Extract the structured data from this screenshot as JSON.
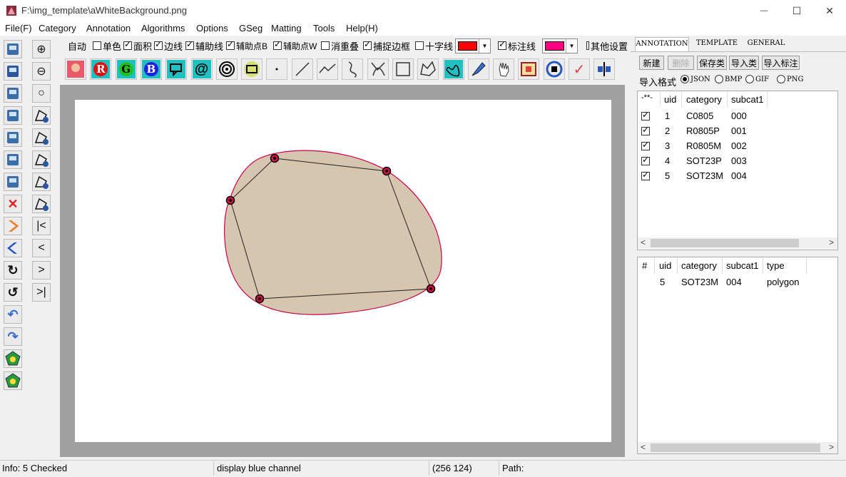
{
  "window": {
    "title": "F:\\img_template\\aWhiteBackground.png",
    "minimize_glyph": "—",
    "maximize_glyph": "☐",
    "close_glyph": "✕"
  },
  "menu": [
    "File(F)",
    "Category",
    "Annotation",
    "Algorithms",
    "Options",
    "GSeg",
    "Matting",
    "Tools",
    "Help(H)"
  ],
  "options_row": {
    "auto_label": "自动",
    "checks": [
      {
        "label": "单色",
        "checked": false
      },
      {
        "label": "面积",
        "checked": true
      },
      {
        "label": "边线",
        "checked": true
      },
      {
        "label": "辅助线",
        "checked": true
      },
      {
        "label": "辅助点B",
        "checked": true
      },
      {
        "label": "辅助点W",
        "checked": true
      },
      {
        "label": "消重叠",
        "checked": false
      },
      {
        "label": "捕捉边框",
        "checked": true
      },
      {
        "label": "十字线",
        "checked": false
      }
    ],
    "color1": "#ff0000",
    "mark_line_label": "标注线",
    "mark_line_checked": true,
    "color2": "#ff0080",
    "other_settings_label": "其他设置",
    "other_settings_checked": false
  },
  "toolbar_icons": [
    "photo-icon",
    "r-channel-icon",
    "g-channel-icon",
    "b-channel-icon",
    "speech-bubble-icon",
    "at-icon",
    "spiral-icon",
    "node-box-icon",
    "point-icon",
    "line-icon",
    "polyline-icon",
    "curve-icon",
    "bezier-icon",
    "rectangle-icon",
    "polygon-icon",
    "freehand-icon",
    "brush-icon",
    "hand-icon",
    "image-frame-icon",
    "record-icon",
    "check-icon",
    "split-icon"
  ],
  "toolbar_letters": {
    "r": "R",
    "g": "G",
    "b": "B",
    "at": "@",
    "check": "✓"
  },
  "left_tools": [
    "open-icon",
    "zoom-in-icon",
    "save-icon",
    "zoom-out-icon",
    "edit-icon",
    "circle-icon",
    "export-icon",
    "polygon-add-icon",
    "copy-icon",
    "shape-add-icon",
    "flip-icon",
    "rect-add-icon",
    "mirror-icon",
    "path-icon",
    "delete-icon",
    "point-add-icon",
    "next-icon",
    "first-icon",
    "prev-orange-icon",
    "prev-icon",
    "redo-icon",
    "next-small-icon",
    "undo-icon",
    "last-icon",
    "back-icon",
    "forward-icon",
    "green-shape-icon",
    "green-shape2-icon"
  ],
  "left_tool_glyphs": {
    "zoom-in-icon": "⊕",
    "zoom-out-icon": "⊖",
    "circle-icon": "○",
    "delete-icon": "✕",
    "first-icon": "|<",
    "prev-icon": "<",
    "next-small-icon": ">",
    "last-icon": ">|",
    "redo-icon": "↻",
    "undo-icon": "↺",
    "back-icon": "↶",
    "forward-icon": "↷"
  },
  "right_panel": {
    "tabs": [
      "ANNOTATION",
      "TEMPLATE",
      "GENERAL"
    ],
    "buttons": {
      "new": "新建",
      "delete": "删除",
      "save_cat": "保存类",
      "import_cat": "导入类",
      "import_ann": "导入标注"
    },
    "import_format_label": "导入格式",
    "formats": [
      {
        "label": "JSON",
        "selected": true
      },
      {
        "label": "BMP",
        "selected": false
      },
      {
        "label": "GIF",
        "selected": false
      },
      {
        "label": "PNG",
        "selected": false
      }
    ],
    "category_table": {
      "headers": [
        "-**-",
        "uid",
        "category",
        "subcat1"
      ],
      "rows": [
        {
          "uid": "1",
          "category": "C0805",
          "subcat1": "000"
        },
        {
          "uid": "2",
          "category": "R0805P",
          "subcat1": "001"
        },
        {
          "uid": "3",
          "category": "R0805M",
          "subcat1": "002"
        },
        {
          "uid": "4",
          "category": "SOT23P",
          "subcat1": "003"
        },
        {
          "uid": "5",
          "category": "SOT23M",
          "subcat1": "004"
        }
      ]
    },
    "annotation_table": {
      "headers": [
        "#",
        "uid",
        "category",
        "subcat1",
        "type"
      ],
      "rows": [
        {
          "num": "",
          "uid": "5",
          "category": "SOT23M",
          "subcat1": "004",
          "type": "polygon"
        }
      ]
    },
    "scroll_left": "<",
    "scroll_right": ">"
  },
  "status": {
    "info": "Info: 5 Checked",
    "channel": "display blue channel",
    "coords": "(256  124)",
    "path": "Path:"
  },
  "colors": {
    "shape_fill": "#d6c6b0",
    "shape_stroke": "#cc0044",
    "vertex": "#cc1144"
  }
}
